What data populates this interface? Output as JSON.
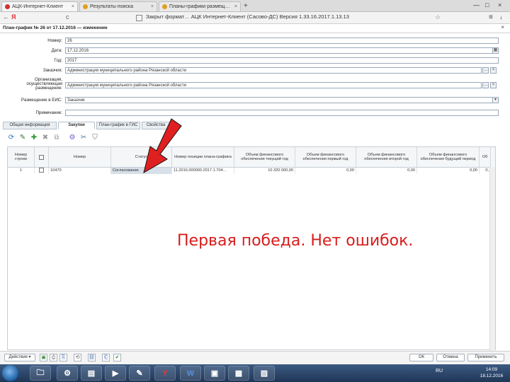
{
  "browser": {
    "tabs": [
      {
        "label": "АЦК-Интернет-Клиент",
        "close": "×",
        "active": true
      },
      {
        "label": "Результаты поиска",
        "close": "×",
        "active": false
      },
      {
        "label": "Планы-графики размещ…",
        "close": "×",
        "active": false
      }
    ],
    "new_tab": "+",
    "back": "←",
    "forward": "Я",
    "reload": "c",
    "address": "Закрыт формат…  АЦК Интернет-Клиент (Сасово-ДС)  Версия 1.33.16.2017.1.13.13",
    "window": {
      "minimize": "—",
      "restore": "□",
      "close": "×"
    },
    "menu": "≡",
    "download": "↓"
  },
  "app": {
    "title": "План-график № 26 от 17.12.2016 — изменение",
    "close": "×",
    "fields": {
      "number": {
        "label": "Номер:",
        "value": "26"
      },
      "date": {
        "label": "Дата:",
        "value": "17.12.2016"
      },
      "year": {
        "label": "Год:",
        "value": "2017"
      },
      "customer": {
        "label": "Заказчик:",
        "value": "Администрация муниципального района Рязанской области"
      },
      "org": {
        "label": "Организация, осуществляющая размещение:",
        "value": "Администрация муниципального района Рязанской области"
      },
      "placement": {
        "label": "Размещение в ЕИС:",
        "value": "Заказчик"
      },
      "note": {
        "label": "Примечание:",
        "value": ""
      }
    },
    "form_tabs": [
      {
        "label": "Общая информация",
        "active": false
      },
      {
        "label": "Закупки",
        "active": true
      },
      {
        "label": "План-график в ГИС",
        "active": false
      },
      {
        "label": "Свойства",
        "active": false
      }
    ],
    "table": {
      "headers": [
        "Номер строки",
        "",
        "Номер",
        "Статус",
        "Номер позиции плана-графика",
        "Объем финансового обеспечения текущий год",
        "Объем финансового обеспечения первый год",
        "Объем финансового обеспечения второй год",
        "Объем финансового обеспечения будущий период",
        "Об"
      ],
      "rows": [
        {
          "line": "1",
          "num": "10470",
          "status": "Согласование",
          "position": "11.2016.000000.2017.1.704…",
          "current": "10 320 000,00",
          "y1": "0,00",
          "y2": "0,00",
          "future": "0,00",
          "extra": "0,"
        }
      ]
    },
    "overlay": "Первая победа. Нет ошибок.",
    "bottom": {
      "actions_label": "Действия ▾",
      "ok_label": "ОК",
      "cancel_label": "Отмена",
      "apply_label": "Применить"
    }
  },
  "taskbar": {
    "apps": [
      "",
      "",
      "",
      "",
      "",
      "Y",
      "W",
      "",
      "",
      ""
    ],
    "tray": "RU",
    "time": "14:09",
    "date": "18.12.2016"
  },
  "colors": {
    "accent_red": "#d71d1d",
    "taskbar": "#2a4568"
  }
}
